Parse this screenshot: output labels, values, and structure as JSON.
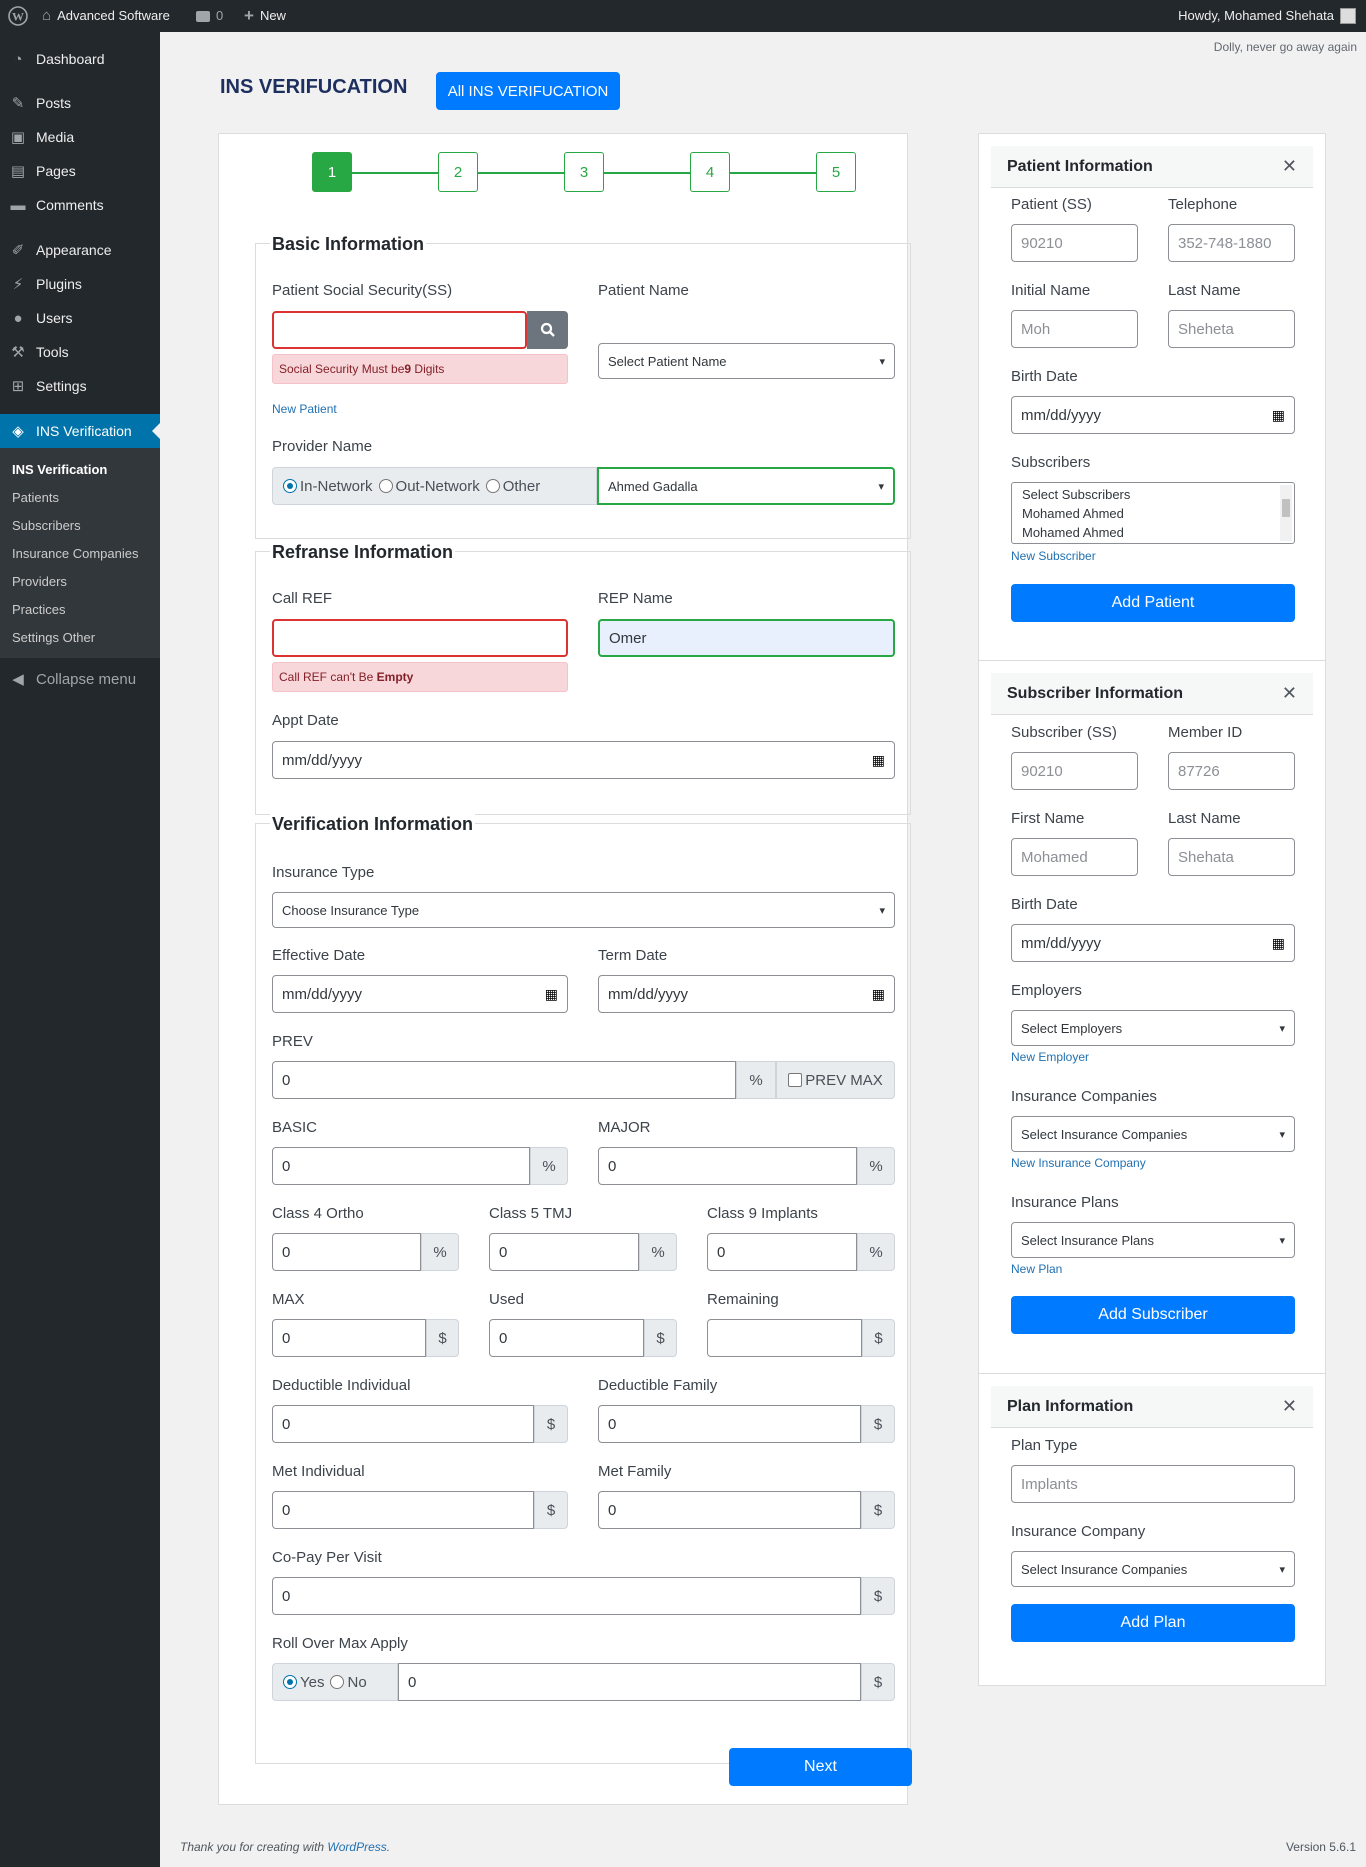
{
  "adminbar": {
    "site_name": "Advanced Software",
    "comments_count": "0",
    "new_label": "New",
    "greeting": "Howdy, Mohamed Shehata"
  },
  "menu": {
    "dashboard": "Dashboard",
    "posts": "Posts",
    "media": "Media",
    "pages": "Pages",
    "comments": "Comments",
    "appearance": "Appearance",
    "plugins": "Plugins",
    "users": "Users",
    "tools": "Tools",
    "settings": "Settings",
    "ins_verification": "INS Verification",
    "submenu": [
      "INS Verification",
      "Patients",
      "Subscribers",
      "Insurance Companies",
      "Providers",
      "Practices",
      "Settings Other"
    ],
    "collapse": "Collapse menu"
  },
  "dolly": "Dolly, never go away again",
  "page": {
    "title": "INS VERIFUCATION",
    "all_button": "All INS VERIFUCATION"
  },
  "steps": [
    "1",
    "2",
    "3",
    "4",
    "5"
  ],
  "basic": {
    "legend": "Basic Information",
    "ss_label": "Patient Social Security(SS)",
    "ss_error_pre": "Social Security Must be ",
    "ss_error_num": "9",
    "ss_error_post": " Digits",
    "new_patient": "New Patient",
    "patient_name_label": "Patient Name",
    "patient_name_value": "Select Patient Name",
    "provider_label": "Provider Name",
    "radio_in": "In-Network",
    "radio_out": "Out-Network",
    "radio_other": "Other",
    "provider_value": "Ahmed Gadalla"
  },
  "ref": {
    "legend": "Refranse Information",
    "call_ref_label": "Call REF",
    "call_ref_error_pre": "Call REF can't Be ",
    "call_ref_error_bold": "Empty",
    "rep_name_label": "REP Name",
    "rep_name_value": "Omer",
    "appt_label": "Appt Date",
    "appt_placeholder": "mm/dd/yyyy"
  },
  "verif": {
    "legend": "Verification Information",
    "ins_type_label": "Insurance Type",
    "ins_type_value": "Choose Insurance Type",
    "eff_label": "Effective Date",
    "term_label": "Term Date",
    "date_placeholder": "mm/dd/yyyy",
    "prev_label": "PREV",
    "prev_value": "0",
    "prev_max": "PREV MAX",
    "basic_label": "BASIC",
    "basic_value": "0",
    "major_label": "MAJOR",
    "major_value": "0",
    "class4_label": "Class 4 Ortho",
    "class4_value": "0",
    "class5_label": "Class 5 TMJ",
    "class5_value": "0",
    "class9_label": "Class 9 Implants",
    "class9_value": "0",
    "max_label": "MAX",
    "max_value": "0",
    "used_label": "Used",
    "used_value": "0",
    "remaining_label": "Remaining",
    "remaining_value": "",
    "ded_ind_label": "Deductible Individual",
    "ded_ind_value": "0",
    "ded_fam_label": "Deductible Family",
    "ded_fam_value": "0",
    "met_ind_label": "Met Individual",
    "met_ind_value": "0",
    "met_fam_label": "Met Family",
    "met_fam_value": "0",
    "copay_label": "Co-Pay Per Visit",
    "copay_value": "0",
    "rollover_label": "Roll Over Max Apply",
    "yes": "Yes",
    "no": "No",
    "rollover_value": "0",
    "percent": "%",
    "dollar": "$"
  },
  "next_button": "Next",
  "patient_panel": {
    "title": "Patient Information",
    "ss_label": "Patient (SS)",
    "ss_placeholder": "90210",
    "tel_label": "Telephone",
    "tel_placeholder": "352-748-1880",
    "initial_label": "Initial Name",
    "initial_placeholder": "Moh",
    "last_label": "Last Name",
    "last_placeholder": "Sheheta",
    "birth_label": "Birth Date",
    "birth_placeholder": "mm/dd/yyyy",
    "subs_label": "Subscribers",
    "subs_options": [
      "Select Subscribers",
      "Mohamed Ahmed",
      "Mohamed Ahmed"
    ],
    "new_subscriber": "New Subscriber",
    "add_button": "Add Patient"
  },
  "subscriber_panel": {
    "title": "Subscriber Information",
    "ss_label": "Subscriber (SS)",
    "ss_placeholder": "90210",
    "member_label": "Member ID",
    "member_placeholder": "87726",
    "first_label": "First Name",
    "first_placeholder": "Mohamed",
    "last_label": "Last Name",
    "last_placeholder": "Shehata",
    "birth_label": "Birth Date",
    "birth_placeholder": "mm/dd/yyyy",
    "employers_label": "Employers",
    "employers_value": "Select Employers",
    "new_employer": "New Employer",
    "ins_comp_label": "Insurance Companies",
    "ins_comp_value": "Select Insurance Companies",
    "new_ins_comp": "New Insurance Company",
    "plans_label": "Insurance Plans",
    "plans_value": "Select Insurance Plans",
    "new_plan": "New Plan",
    "add_button": "Add Subscriber"
  },
  "plan_panel": {
    "title": "Plan Information",
    "type_label": "Plan Type",
    "type_placeholder": "Implants",
    "company_label": "Insurance Company",
    "company_value": "Select Insurance Companies",
    "add_button": "Add Plan"
  },
  "footer": {
    "thanks_pre": "Thank you for creating with ",
    "thanks_link": "WordPress",
    "thanks_post": ".",
    "version": "Version 5.6.1"
  },
  "colors": {
    "primary": "#007bff",
    "success": "#28a745",
    "danger": "#dc3232",
    "admin_dark": "#23282d",
    "admin_blue": "#0073aa"
  }
}
